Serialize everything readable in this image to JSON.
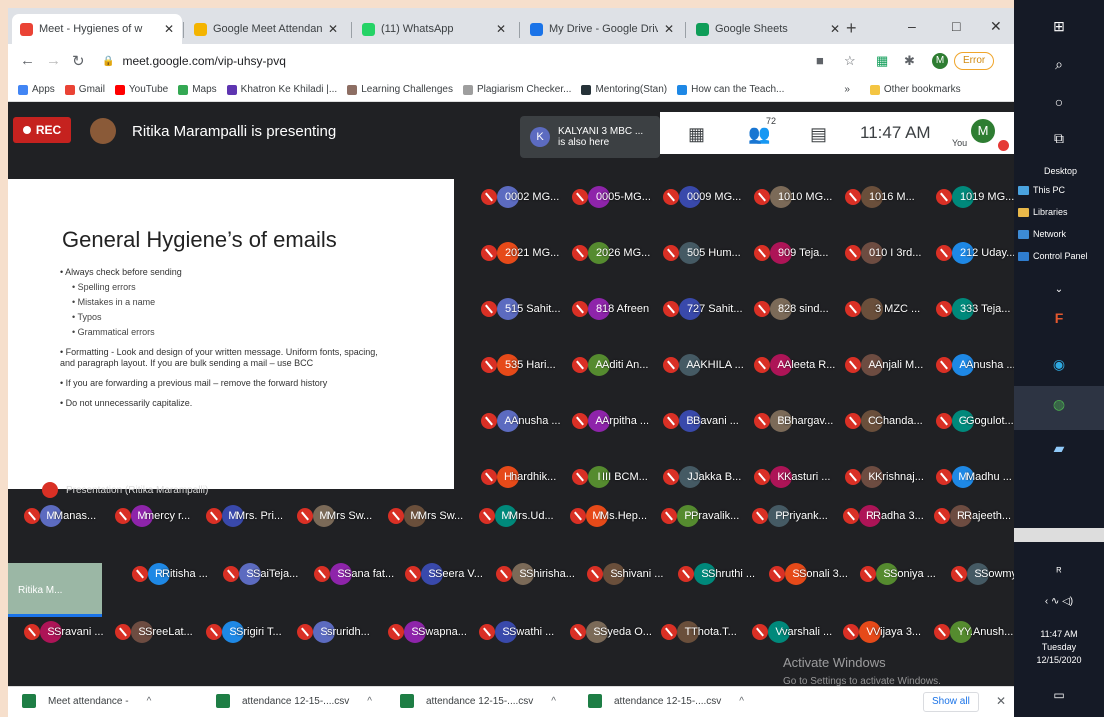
{
  "tabs": [
    {
      "label": "Meet - Hygienes of w",
      "color": "#ea4335"
    },
    {
      "label": "Google Meet Attendance",
      "color": "#f4b400"
    },
    {
      "label": "(11) WhatsApp",
      "color": "#25d366"
    },
    {
      "label": "My Drive - Google Drive",
      "color": "#1a73e8"
    },
    {
      "label": "Google Sheets",
      "color": "#0f9d58"
    }
  ],
  "toolbar": {
    "url": "meet.google.com/vip-uhsy-pvq",
    "profile_initial": "M",
    "error_label": "Error"
  },
  "bookmarks": [
    {
      "label": "Apps",
      "color": "#4285f4"
    },
    {
      "label": "Gmail",
      "color": "#ea4335"
    },
    {
      "label": "YouTube",
      "color": "#ff0000"
    },
    {
      "label": "Maps",
      "color": "#34a853"
    },
    {
      "label": "Khatron Ke Khiladi |...",
      "color": "#5e35b1"
    },
    {
      "label": "Learning Challenges",
      "color": "#8d6e63"
    },
    {
      "label": "Plagiarism Checker...",
      "color": "#9e9e9e"
    },
    {
      "label": "Mentoring(Stan)",
      "color": "#263238"
    },
    {
      "label": "How can the Teach...",
      "color": "#1e88e5"
    }
  ],
  "bookmarks_other": "Other bookmarks",
  "bookmarks_more": "»",
  "meet": {
    "rec_label": "REC",
    "presenting": "Ritika Marampalli is presenting",
    "also_here_initial": "K",
    "also_here_name": "KALYANI 3 MBC ...",
    "also_here_text": "is also here",
    "people_count": "72",
    "time": "11:47 AM",
    "you_label": "You",
    "you_initial": "M",
    "presentation_label": "Presentation (Ritika Marampalli)",
    "self_name": "Ritika M..."
  },
  "slide": {
    "title": "General Hygiene’s  of emails",
    "bullets": [
      {
        "level": 1,
        "text": "Always check before sending"
      },
      {
        "level": 2,
        "text": "Spelling errors"
      },
      {
        "level": 2,
        "text": "Mistakes in a name"
      },
      {
        "level": 2,
        "text": "Typos"
      },
      {
        "level": 2,
        "text": "Grammatical errors"
      },
      {
        "level": 1,
        "text": "Formatting - Look and design of your written message. Uniform fonts, spacing, and paragraph layout. If you are bulk sending a mail – use BCC"
      },
      {
        "level": 1,
        "text": "If you are forwarding a previous mail – remove the forward history"
      },
      {
        "level": 1,
        "text": "Do not unnecessarily capitalize."
      }
    ]
  },
  "participants_right": [
    [
      "002 MG...",
      "005-MG...",
      "009 MG...",
      "010 MG...",
      "016 M...",
      "019 MG..."
    ],
    [
      "021 MG...",
      "026 MG...",
      "05 Hum...",
      "09 Teja...",
      "10 I 3rd...",
      "12 Uday..."
    ],
    [
      "15 Sahit...",
      "18 Afreen",
      "27 Sahit...",
      "28 sind...",
      "3 MZC ...",
      "33 Teja..."
    ],
    [
      "35 Hari...",
      "Aditi An...",
      "AKHILA ...",
      "Aleeta R...",
      "Anjali M...",
      "Anusha ..."
    ],
    [
      "Anusha ...",
      "Arpitha ...",
      "Bavani ...",
      "Bhargav...",
      "Chanda...",
      "Gogulot..."
    ],
    [
      "hardhik...",
      "III BCM...",
      "Jakka B...",
      "Kasturi ...",
      "Krishnaj...",
      "Madhu ..."
    ]
  ],
  "participants_bottom": [
    [
      "Manas...",
      "mercy r...",
      "Mrs. Pri...",
      "Mrs Sw...",
      "Mrs Sw...",
      "Mrs.Ud...",
      "Ms.Hep...",
      "Pravalik...",
      "Priyank...",
      "Radha 3...",
      "Rajeeth..."
    ],
    [
      "Ritisha ...",
      "SaiTeja...",
      "Sana fat...",
      "Seera V...",
      "Shirisha...",
      "shivani ...",
      "Shruthi ...",
      "Sonali 3...",
      "Soniya ...",
      "Sowmy..."
    ],
    [
      "Sravani ...",
      "SreeLat...",
      "Srigiri T...",
      "sruridh...",
      "Swapna...",
      "Swathi ...",
      "Syeda O...",
      "Thota.T...",
      "varshali ...",
      "Vijaya 3...",
      "Y.Anush..."
    ]
  ],
  "downloads": [
    "Meet attendance -",
    "attendance 12-15-....csv",
    "attendance 12-15-....csv",
    "attendance 12-15-....csv"
  ],
  "show_all": "Show all",
  "activate": {
    "line1": "Activate Windows",
    "line2": "Go to Settings to activate Windows."
  },
  "taskbar": {
    "desktop": "Desktop",
    "items": [
      "This PC",
      "Libraries",
      "Network",
      "Control Panel"
    ],
    "time": "11:47 AM",
    "day": "Tuesday",
    "date": "12/15/2020"
  }
}
